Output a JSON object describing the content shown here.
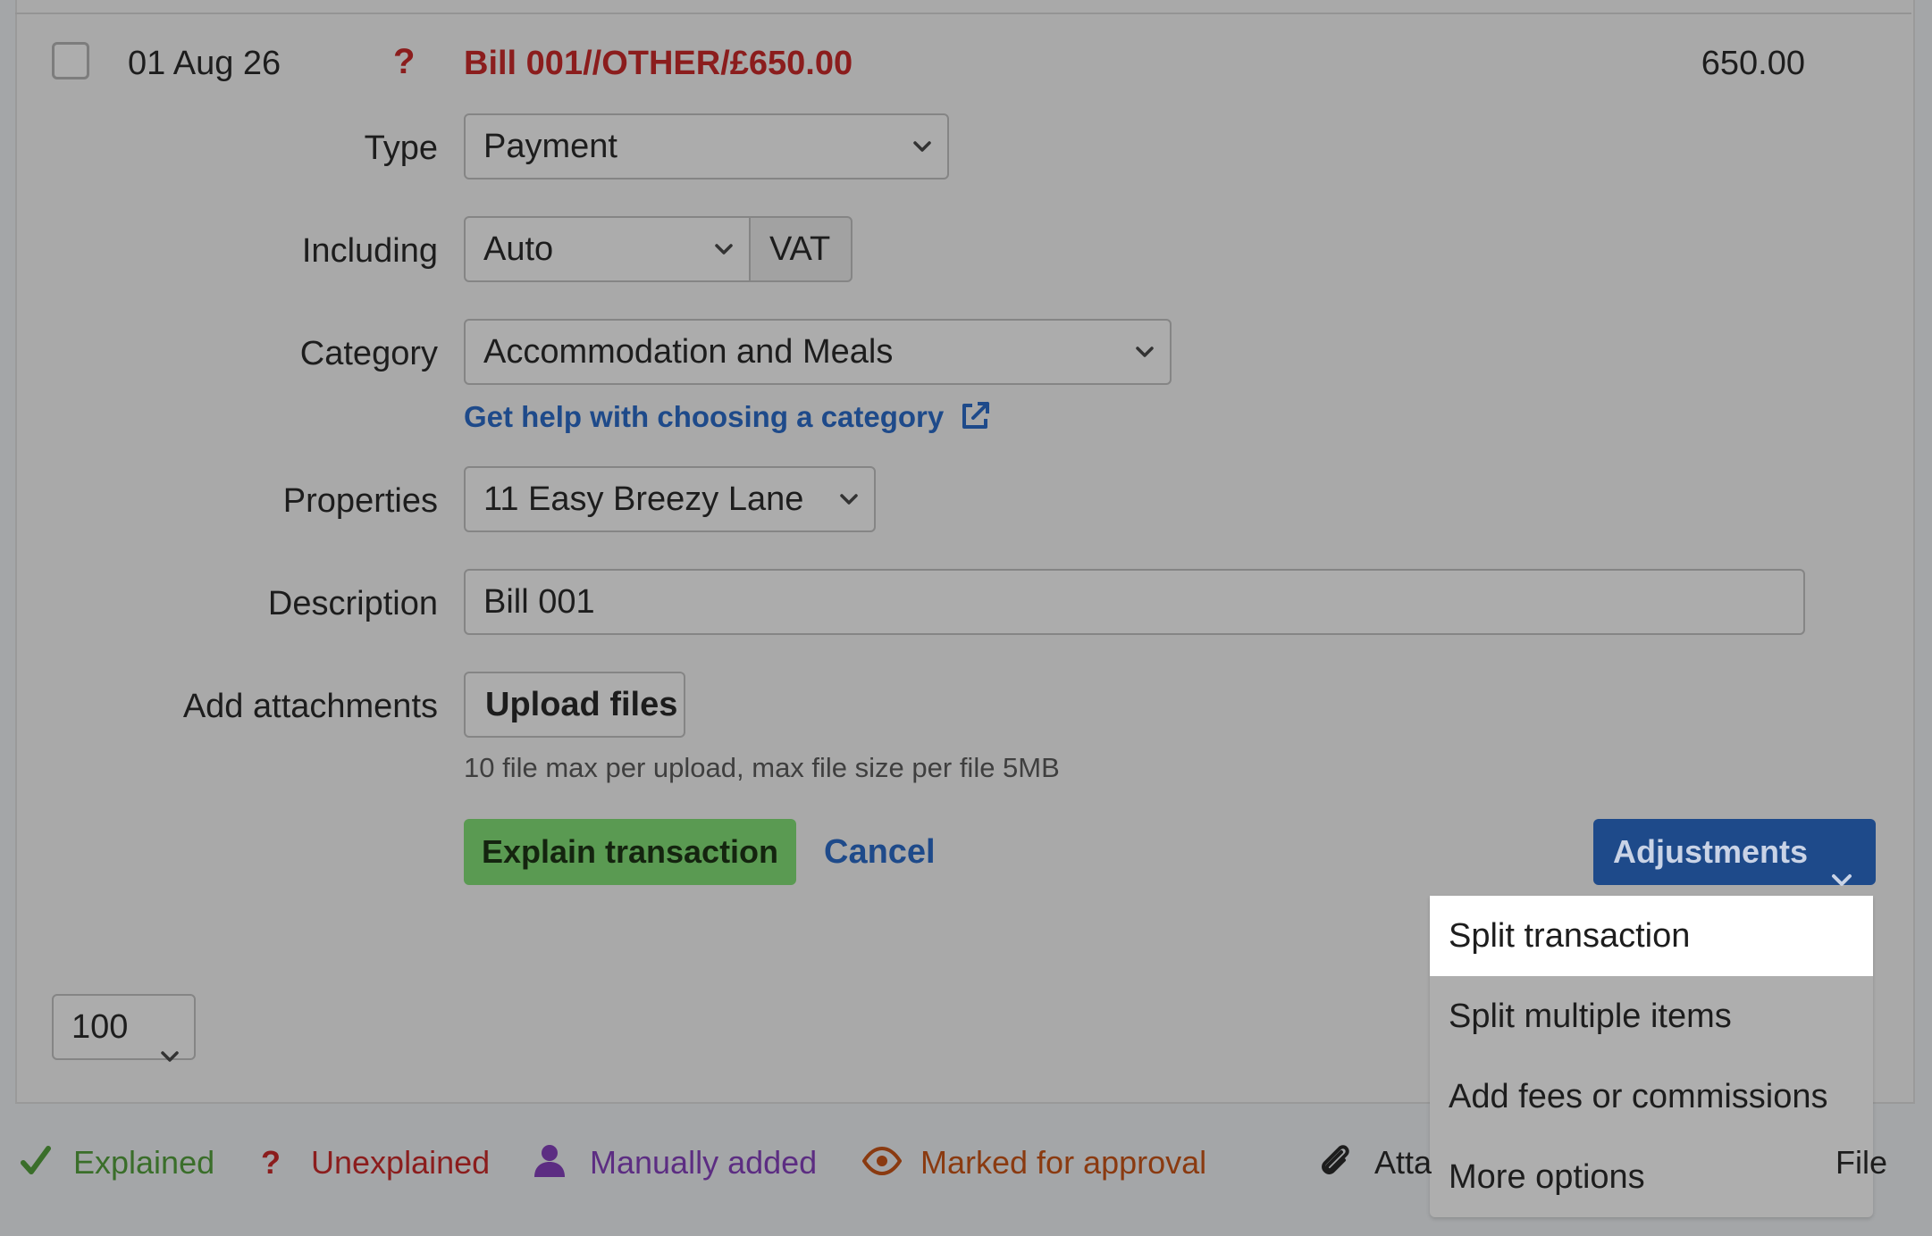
{
  "transaction": {
    "date": "01 Aug 26",
    "status_icon": "question-icon",
    "title": "Bill 001//OTHER/£650.00",
    "amount": "650.00"
  },
  "form": {
    "type_label": "Type",
    "type_value": "Payment",
    "including_label": "Including",
    "including_value": "Auto",
    "vat_addon": "VAT",
    "category_label": "Category",
    "category_value": "Accommodation and Meals",
    "category_help_link": "Get help with choosing a category",
    "properties_label": "Properties",
    "properties_value": "11 Easy Breezy Lane",
    "description_label": "Description",
    "description_value": "Bill 001",
    "attachments_label": "Add attachments",
    "upload_button": "Upload files",
    "upload_hint": "10 file max per upload, max file size per file 5MB"
  },
  "actions": {
    "explain_button": "Explain transaction",
    "cancel_button": "Cancel",
    "adjustments_button": "Adjustments"
  },
  "adjustments_menu": [
    {
      "label": "Split transaction",
      "active": true
    },
    {
      "label": "Split multiple items",
      "active": false
    },
    {
      "label": "Add fees or commissions",
      "active": false
    },
    {
      "label": "More options",
      "active": false
    }
  ],
  "pager": {
    "per_page_value": "100"
  },
  "legend": {
    "explained": "Explained",
    "unexplained": "Unexplained",
    "manually_added": "Manually added",
    "marked_for_approval": "Marked for approval",
    "attachment_partial": "Atta",
    "file_partial": "File"
  },
  "colors": {
    "link_blue": "#1e4a8a",
    "unexplained_red": "#8b1d1d",
    "explained_green": "#3a6e2a",
    "manual_purple": "#5c2d82",
    "approval_orange": "#8a3a10",
    "explain_button_green": "#5a9a52",
    "adjustments_button_blue": "#1e4a8a"
  }
}
